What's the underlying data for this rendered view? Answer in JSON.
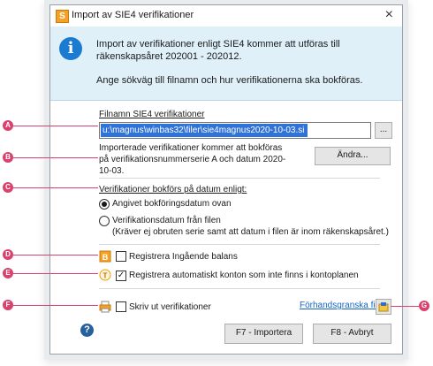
{
  "window": {
    "title": "Import av SIE4 verifikationer",
    "close": "×"
  },
  "info": {
    "line1": "Import av verifikationer enligt SIE4 kommer att utföras till räkenskapsåret 202001 - 202012.",
    "line2": "Ange sökväg till filnamn och hur verifikationerna ska bokföras."
  },
  "file": {
    "label": "Filnamn SIE4 verifikationer",
    "value": "u:\\magnus\\winbas32\\filer\\sie4magnus2020-10-03.si",
    "browse_label": "..."
  },
  "series_info": {
    "text": "Importerade verifikationer kommer att bokföras på verifikationsnummerserie A och datum 2020-10-03.",
    "change_label": "Ändra..."
  },
  "date_section": {
    "label": "Verifikationer bokförs på datum enligt:",
    "options": [
      {
        "label": "Angivet bokföringsdatum ovan",
        "selected": true
      },
      {
        "label": "Verifikationsdatum från filen",
        "selected": false
      }
    ],
    "note": "(Kräver ej obruten serie samt att datum i filen är inom räkenskapsåret.)"
  },
  "checks": {
    "ingaende_balans": {
      "label": "Registrera Ingående balans",
      "checked": false
    },
    "auto_konton": {
      "label": "Registrera automatiskt konton som inte finns i kontoplanen",
      "checked": true
    },
    "skriv_ut": {
      "label": "Skriv ut verifikationer",
      "checked": false
    }
  },
  "preview_link": "Förhandsgranska fil",
  "buttons": {
    "import": "F7 - Importera",
    "cancel": "F8 - Avbryt"
  },
  "callouts": [
    "A",
    "B",
    "C",
    "D",
    "E",
    "F",
    "G"
  ],
  "icons": {
    "app": "app-icon",
    "info": "info-icon",
    "help": "help-icon"
  },
  "colors": {
    "callout": "#d8426c",
    "selection": "#2f73d9",
    "info_band": "#dff0f9"
  }
}
